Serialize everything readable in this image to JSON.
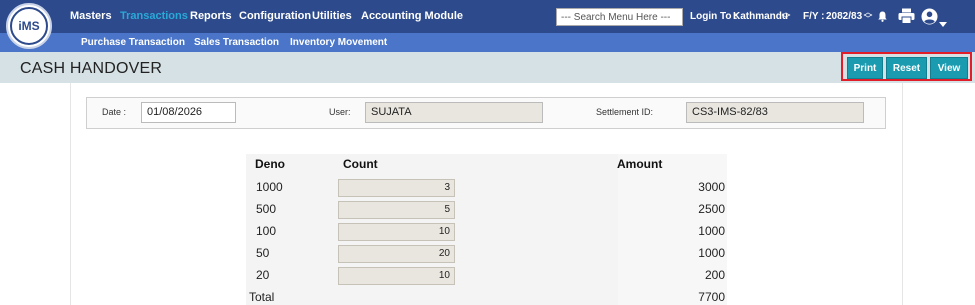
{
  "app": {
    "logo_text": "iMS"
  },
  "nav": {
    "items": [
      {
        "label": "Masters"
      },
      {
        "label": "Transactions",
        "active": true
      },
      {
        "label": "Reports"
      },
      {
        "label": "Configuration"
      },
      {
        "label": "Utilities"
      },
      {
        "label": "Accounting Module"
      }
    ],
    "search_placeholder": "--- Search Menu Here ---",
    "login_label": "Login To :",
    "login_value": "Kathmandu",
    "fy_label": "F/Y :",
    "fy_value": "2082/83"
  },
  "subnav": {
    "items": [
      {
        "label": "Purchase Transaction"
      },
      {
        "label": "Sales Transaction"
      },
      {
        "label": "Inventory Movement"
      }
    ]
  },
  "page": {
    "title": "CASH HANDOVER"
  },
  "toolbar": {
    "print_label": "Print",
    "reset_label": "Reset",
    "view_label": "View"
  },
  "form": {
    "date_label": "Date :",
    "date_value": "01/08/2026",
    "user_label": "User:",
    "user_value": "SUJATA",
    "settlement_label": "Settlement ID:",
    "settlement_value": "CS3-IMS-82/83"
  },
  "denominations": {
    "headers": {
      "deno": "Deno",
      "count": "Count",
      "amount": "Amount"
    },
    "rows": [
      {
        "deno": "1000",
        "count": "3",
        "amount": "3000"
      },
      {
        "deno": "500",
        "count": "5",
        "amount": "2500"
      },
      {
        "deno": "100",
        "count": "10",
        "amount": "1000"
      },
      {
        "deno": "50",
        "count": "20",
        "amount": "1000"
      },
      {
        "deno": "20",
        "count": "10",
        "amount": "200"
      }
    ],
    "total_label": "Total",
    "total_amount": "7700"
  },
  "colors": {
    "nav_bg": "#2d4b8c",
    "subnav_bg": "#4a75c8",
    "accent": "#1a9bb0",
    "highlight": "#e11d2a"
  }
}
